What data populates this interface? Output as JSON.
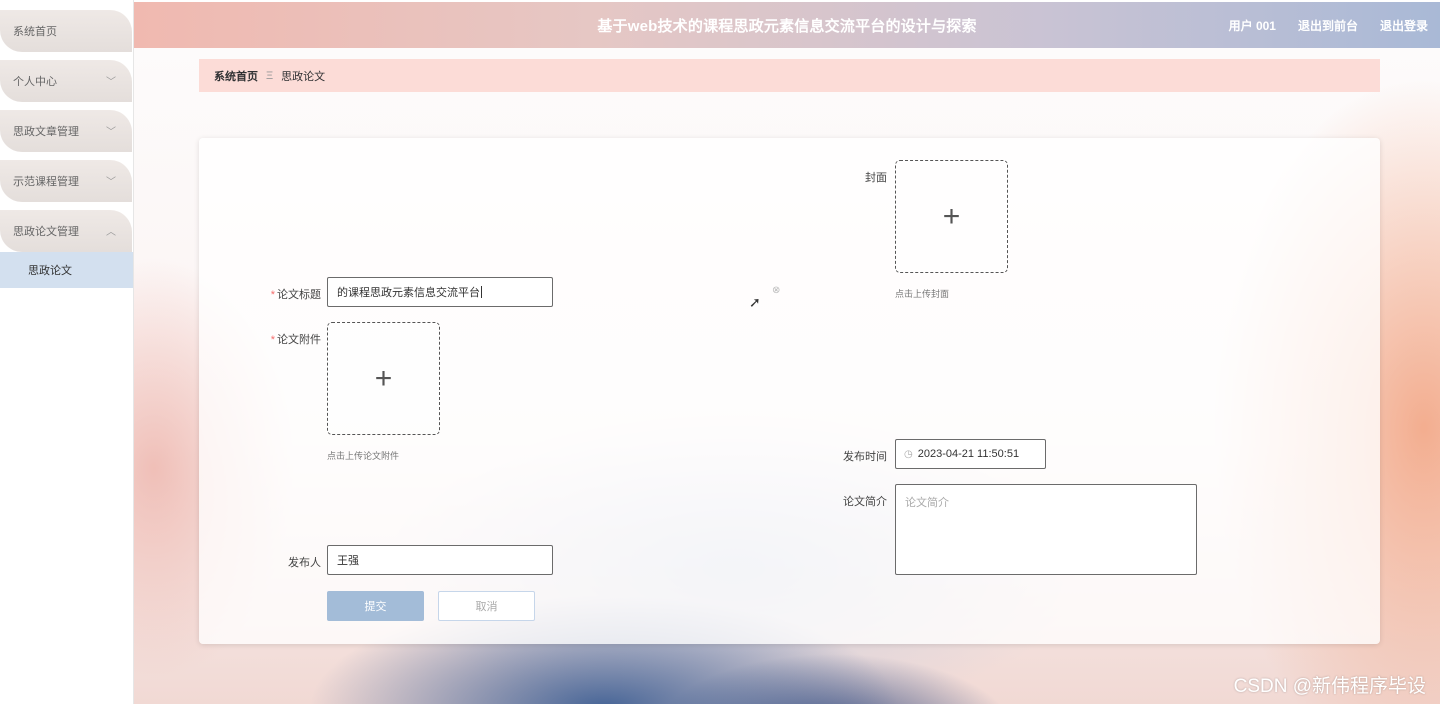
{
  "header": {
    "title": "基于web技术的课程思政元素信息交流平台的设计与探索",
    "user": "用户 001",
    "goto_front": "退出到前台",
    "logout": "退出登录"
  },
  "sidebar": {
    "items": [
      {
        "label": "系统首页"
      },
      {
        "label": "个人中心",
        "chevron": "chevron-down-icon"
      },
      {
        "label": "思政文章管理",
        "chevron": "chevron-down-icon"
      },
      {
        "label": "示范课程管理",
        "chevron": "chevron-down-icon"
      },
      {
        "label": "思政论文管理",
        "chevron": "chevron-up-icon"
      }
    ],
    "subitem": "思政论文"
  },
  "breadcrumb": {
    "home": "系统首页",
    "separator": "Ξ",
    "current": "思政论文"
  },
  "form": {
    "title_label": "论文标题",
    "title_value": "的课程思政元素信息交流平台",
    "attachment_label": "论文附件",
    "attachment_hint": "点击上传论文附件",
    "cover_label": "封面",
    "cover_hint": "点击上传封面",
    "publish_time_label": "发布时间",
    "publish_time_value": "2023-04-21 11:50:51",
    "intro_label": "论文简介",
    "intro_placeholder": "论文简介",
    "publisher_label": "发布人",
    "publisher_value": "王强",
    "submit_label": "提交",
    "cancel_label": "取消"
  },
  "watermark": "CSDN @新伟程序毕设"
}
